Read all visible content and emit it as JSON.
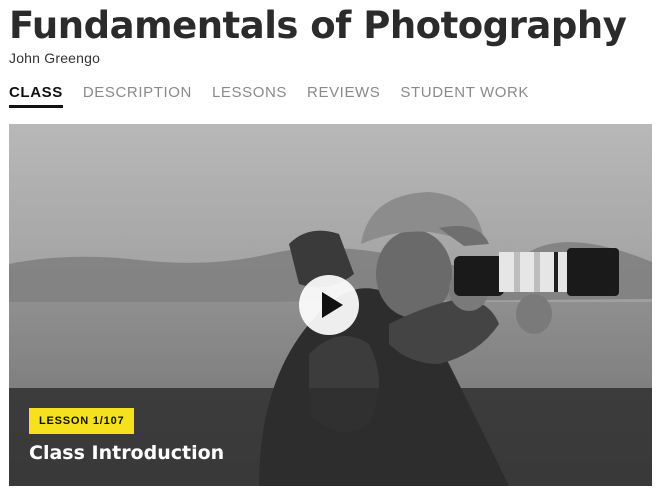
{
  "header": {
    "title": "Fundamentals of Photography",
    "author": "John Greengo"
  },
  "tabs": [
    {
      "label": "CLASS",
      "active": true
    },
    {
      "label": "DESCRIPTION",
      "active": false
    },
    {
      "label": "LESSONS",
      "active": false
    },
    {
      "label": "REVIEWS",
      "active": false
    },
    {
      "label": "STUDENT WORK",
      "active": false
    }
  ],
  "video": {
    "play_icon": "play-icon",
    "lesson_badge": "LESSON 1/107",
    "lesson_title": "Class Introduction"
  },
  "colors": {
    "badge_background": "#f5e11e",
    "active_tab": "#111111",
    "inactive_tab": "#8a8a8a"
  }
}
